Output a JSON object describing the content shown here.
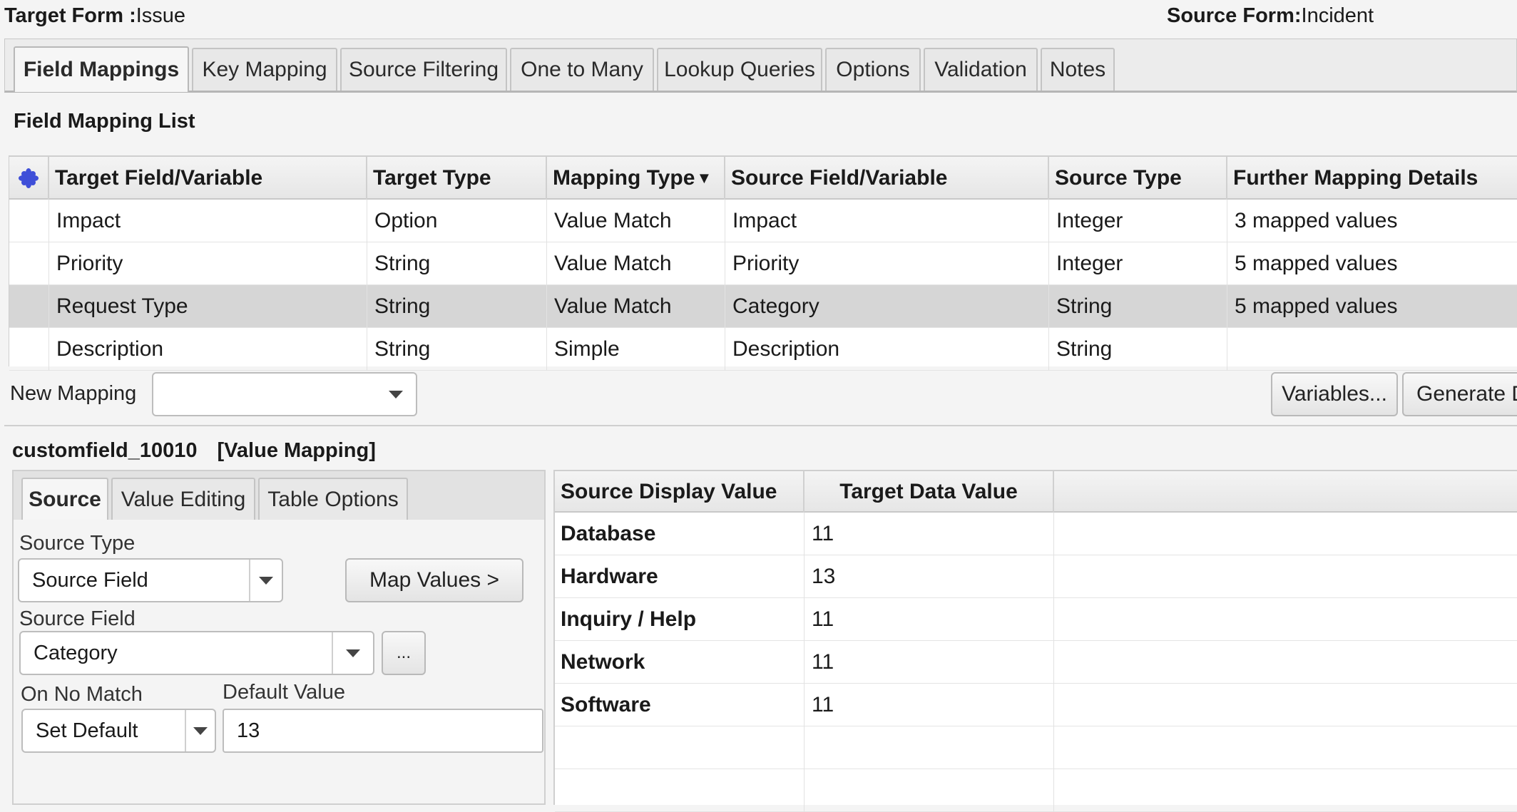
{
  "header": {
    "target_form_label": "Target Form :",
    "target_form_value": "Issue",
    "source_form_label": "Source Form:",
    "source_form_value": "Incident"
  },
  "tabs": [
    {
      "label": "Field Mappings",
      "active": true
    },
    {
      "label": "Key Mapping"
    },
    {
      "label": "Source Filtering"
    },
    {
      "label": "One to Many"
    },
    {
      "label": "Lookup Queries"
    },
    {
      "label": "Options"
    },
    {
      "label": "Validation"
    },
    {
      "label": "Notes"
    }
  ],
  "field_mapping": {
    "title": "Field Mapping List",
    "columns": [
      "Target Field/Variable",
      "Target Type",
      "Mapping Type",
      "Source Field/Variable",
      "Source Type",
      "Further Mapping Details"
    ],
    "sort_indicator": "▼",
    "rows": [
      {
        "target": "Impact",
        "target_type": "Option",
        "mapping_type": "Value Match",
        "source": "Impact",
        "source_type": "Integer",
        "details": "3 mapped values"
      },
      {
        "target": "Priority",
        "target_type": "String",
        "mapping_type": "Value Match",
        "source": "Priority",
        "source_type": "Integer",
        "details": "5 mapped values"
      },
      {
        "target": "Request Type",
        "target_type": "String",
        "mapping_type": "Value Match",
        "source": "Category",
        "source_type": "String",
        "details": "5 mapped values",
        "selected": true
      },
      {
        "target": "Description",
        "target_type": "String",
        "mapping_type": "Simple",
        "source": "Description",
        "source_type": "String",
        "details": ""
      }
    ],
    "new_mapping_label": "New Mapping",
    "new_mapping_value": "",
    "variables_button": "Variables...",
    "generate_button": "Generate D"
  },
  "detail": {
    "field_name": "customfield_10010",
    "mapping_kind": "[Value Mapping]",
    "sub_tabs": [
      {
        "label": "Source",
        "active": true
      },
      {
        "label": "Value Editing"
      },
      {
        "label": "Table Options"
      }
    ],
    "source_type_label": "Source Type",
    "source_type_value": "Source Field",
    "map_values_button": "Map Values >",
    "source_field_label": "Source Field",
    "source_field_value": "Category",
    "browse_button": "...",
    "on_no_match_label": "On No Match",
    "on_no_match_value": "Set Default",
    "default_value_label": "Default Value",
    "default_value": "13"
  },
  "value_table": {
    "columns": [
      "Source Display Value",
      "Target Data Value"
    ],
    "rows": [
      {
        "source": "Database",
        "target": "11"
      },
      {
        "source": "Hardware",
        "target": "13"
      },
      {
        "source": "Inquiry / Help",
        "target": "11"
      },
      {
        "source": "Network",
        "target": "11"
      },
      {
        "source": "Software",
        "target": "11"
      }
    ]
  },
  "colors": {
    "selected_row": "#d6d6d6",
    "star_icon": "#3f4fd8"
  },
  "icons": {
    "column_chooser": "star-icon",
    "dropdown": "chevron-down-icon"
  }
}
